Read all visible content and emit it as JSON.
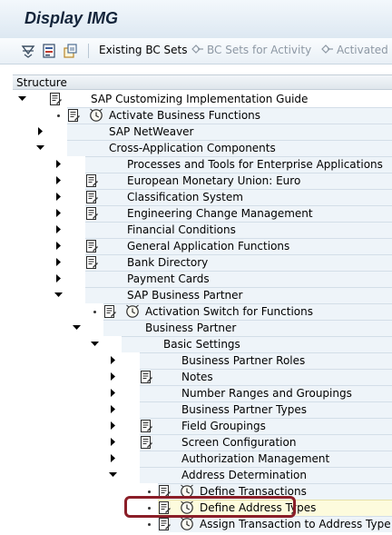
{
  "window": {
    "title": "Display IMG"
  },
  "toolbar": {
    "buttons": [
      {
        "label": "Existing BC Sets",
        "enabled": true
      },
      {
        "label": "BC Sets for Activity",
        "enabled": false
      },
      {
        "label": "Activated B",
        "enabled": false
      }
    ]
  },
  "structure": {
    "header": "Structure",
    "nodes": [
      {
        "label": "SAP Customizing Implementation Guide",
        "level": 0,
        "state": "expanded",
        "doc": true,
        "exec": false
      },
      {
        "label": "Activate Business Functions",
        "level": 1,
        "state": "leaf",
        "doc": true,
        "exec": true
      },
      {
        "label": "SAP NetWeaver",
        "level": 1,
        "state": "collapsed",
        "doc": false,
        "exec": false
      },
      {
        "label": "Cross-Application Components",
        "level": 1,
        "state": "expanded",
        "doc": false,
        "exec": false
      },
      {
        "label": "Processes and Tools for Enterprise Applications",
        "level": 2,
        "state": "collapsed",
        "doc": false,
        "exec": false
      },
      {
        "label": "European Monetary Union: Euro",
        "level": 2,
        "state": "collapsed",
        "doc": true,
        "exec": false
      },
      {
        "label": "Classification System",
        "level": 2,
        "state": "collapsed",
        "doc": true,
        "exec": false
      },
      {
        "label": "Engineering Change Management",
        "level": 2,
        "state": "collapsed",
        "doc": true,
        "exec": false
      },
      {
        "label": "Financial Conditions",
        "level": 2,
        "state": "collapsed",
        "doc": false,
        "exec": false
      },
      {
        "label": "General Application Functions",
        "level": 2,
        "state": "collapsed",
        "doc": true,
        "exec": false
      },
      {
        "label": "Bank Directory",
        "level": 2,
        "state": "collapsed",
        "doc": true,
        "exec": false
      },
      {
        "label": "Payment Cards",
        "level": 2,
        "state": "collapsed",
        "doc": false,
        "exec": false
      },
      {
        "label": "SAP Business Partner",
        "level": 2,
        "state": "expanded",
        "doc": false,
        "exec": false
      },
      {
        "label": "Activation Switch for Functions",
        "level": 3,
        "state": "leaf",
        "doc": true,
        "exec": true
      },
      {
        "label": "Business Partner",
        "level": 3,
        "state": "expanded",
        "doc": false,
        "exec": false
      },
      {
        "label": "Basic Settings",
        "level": 4,
        "state": "expanded",
        "doc": false,
        "exec": false
      },
      {
        "label": "Business Partner Roles",
        "level": 5,
        "state": "collapsed",
        "doc": false,
        "exec": false
      },
      {
        "label": "Notes",
        "level": 5,
        "state": "collapsed",
        "doc": true,
        "exec": false
      },
      {
        "label": "Number Ranges and Groupings",
        "level": 5,
        "state": "collapsed",
        "doc": false,
        "exec": false
      },
      {
        "label": "Business Partner Types",
        "level": 5,
        "state": "collapsed",
        "doc": false,
        "exec": false
      },
      {
        "label": "Field Groupings",
        "level": 5,
        "state": "collapsed",
        "doc": true,
        "exec": false
      },
      {
        "label": "Screen Configuration",
        "level": 5,
        "state": "collapsed",
        "doc": true,
        "exec": false
      },
      {
        "label": "Authorization Management",
        "level": 5,
        "state": "collapsed",
        "doc": false,
        "exec": false
      },
      {
        "label": "Address Determination",
        "level": 5,
        "state": "expanded",
        "doc": false,
        "exec": false
      },
      {
        "label": "Define Transactions",
        "level": 6,
        "state": "leaf",
        "doc": true,
        "exec": true
      },
      {
        "label": "Define Address Types",
        "level": 6,
        "state": "leaf",
        "doc": true,
        "exec": true,
        "selected": true
      },
      {
        "label": "Assign Transaction to Address Type",
        "level": 6,
        "state": "leaf",
        "doc": true,
        "exec": true
      }
    ]
  },
  "colors": {
    "selection": "#8b1e28",
    "band": "#eef4f9",
    "highlight": "#fdfbdd",
    "arrow": "#000000"
  }
}
